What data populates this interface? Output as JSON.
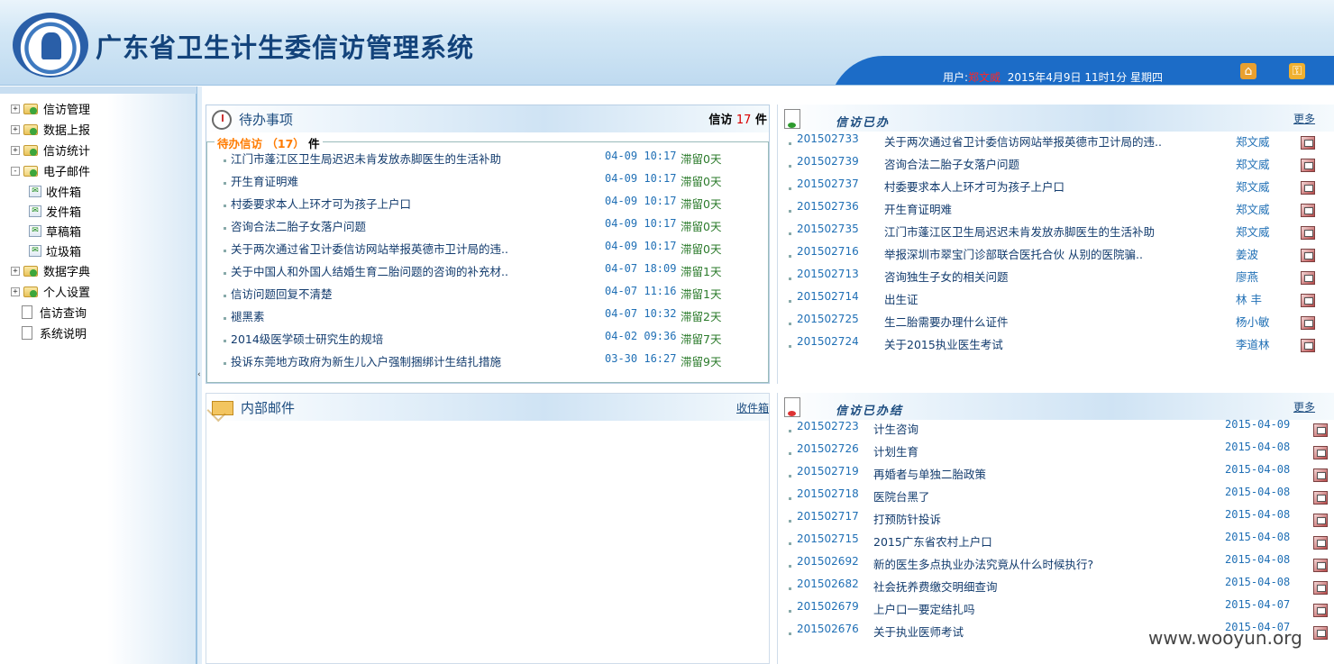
{
  "header": {
    "title": "广东省卫生计生委信访管理系统",
    "user_label": "用户:",
    "user_name": "郑文威",
    "datetime": "2015年4月9日  11时1分  星期四",
    "icons": [
      "home-icon",
      "key-icon"
    ]
  },
  "sidebar": {
    "items": [
      {
        "label": "信访管理",
        "expander": "+",
        "icon": "folder"
      },
      {
        "label": "数据上报",
        "expander": "+",
        "icon": "folder"
      },
      {
        "label": "信访统计",
        "expander": "+",
        "icon": "folder"
      },
      {
        "label": "电子邮件",
        "expander": "-",
        "icon": "folder-open"
      },
      {
        "label": "收件箱",
        "sub": true
      },
      {
        "label": "发件箱",
        "sub": true
      },
      {
        "label": "草稿箱",
        "sub": true
      },
      {
        "label": "垃圾箱",
        "sub": true
      },
      {
        "label": "数据字典",
        "expander": "+",
        "icon": "folder"
      },
      {
        "label": "个人设置",
        "expander": "+",
        "icon": "folder"
      },
      {
        "label": "信访查询",
        "icon": "page"
      },
      {
        "label": "系统说明",
        "icon": "page"
      }
    ],
    "collapse_handle": "‹"
  },
  "todo": {
    "title": "待办事项",
    "count_label": "信访",
    "count": "17",
    "count_unit": "件",
    "legend_label": "待办信访",
    "legend_count": "（17）",
    "legend_unit": "件",
    "items": [
      {
        "title": "江门市蓬江区卫生局迟迟未肯发放赤脚医生的生活补助",
        "time": "04-09 10:17",
        "status": "滞留0天"
      },
      {
        "title": "开生育证明难",
        "time": "04-09 10:17",
        "status": "滞留0天"
      },
      {
        "title": "村委要求本人上环才可为孩子上户口",
        "time": "04-09 10:17",
        "status": "滞留0天"
      },
      {
        "title": "咨询合法二胎子女落户问题",
        "time": "04-09 10:17",
        "status": "滞留0天"
      },
      {
        "title": "关于两次通过省卫计委信访网站举报英德市卫计局的违..",
        "time": "04-09 10:17",
        "status": "滞留0天"
      },
      {
        "title": "关于中国人和外国人结婚生育二胎问题的咨询的补充材..",
        "time": "04-07 18:09",
        "status": "滞留1天"
      },
      {
        "title": "信访问题回复不清楚",
        "time": "04-07 11:16",
        "status": "滞留1天"
      },
      {
        "title": "褪黑素",
        "time": "04-07 10:32",
        "status": "滞留2天"
      },
      {
        "title": "2014级医学硕士研究生的规培",
        "time": "04-02 09:36",
        "status": "滞留7天"
      },
      {
        "title": "投诉东莞地方政府为新生儿入户强制捆绑计生结扎措施",
        "time": "03-30 16:27",
        "status": "滞留9天"
      }
    ]
  },
  "done": {
    "title": "信访已办",
    "more": "更多",
    "items": [
      {
        "id": "201502733",
        "title": "关于两次通过省卫计委信访网站举报英德市卫计局的违..",
        "person": "郑文威"
      },
      {
        "id": "201502739",
        "title": "咨询合法二胎子女落户问题",
        "person": "郑文威"
      },
      {
        "id": "201502737",
        "title": "村委要求本人上环才可为孩子上户口",
        "person": "郑文威"
      },
      {
        "id": "201502736",
        "title": "开生育证明难",
        "person": "郑文威"
      },
      {
        "id": "201502735",
        "title": "江门市蓬江区卫生局迟迟未肯发放赤脚医生的生活补助",
        "person": "郑文威"
      },
      {
        "id": "201502716",
        "title": "举报深圳市翠宝门诊部联合医托合伙  从别的医院骗..",
        "person": "姜波"
      },
      {
        "id": "201502713",
        "title": "咨询独生子女的相关问题",
        "person": "廖燕"
      },
      {
        "id": "201502714",
        "title": "出生证",
        "person": "林  丰"
      },
      {
        "id": "201502725",
        "title": "生二胎需要办理什么证件",
        "person": "杨小敏"
      },
      {
        "id": "201502724",
        "title": "关于2015执业医生考试",
        "person": "李道林"
      }
    ]
  },
  "mail": {
    "title": "内部邮件",
    "inbox_link": "收件箱"
  },
  "closed": {
    "title": "信访已办结",
    "more": "更多",
    "items": [
      {
        "id": "201502723",
        "title": "计生咨询",
        "date": "2015-04-09"
      },
      {
        "id": "201502726",
        "title": "计划生育",
        "date": "2015-04-08"
      },
      {
        "id": "201502719",
        "title": "再婚者与单独二胎政策",
        "date": "2015-04-08"
      },
      {
        "id": "201502718",
        "title": "医院台黑了",
        "date": "2015-04-08"
      },
      {
        "id": "201502717",
        "title": "打预防针投诉",
        "date": "2015-04-08"
      },
      {
        "id": "201502715",
        "title": "2015广东省农村上户口",
        "date": "2015-04-08"
      },
      {
        "id": "201502692",
        "title": "新的医生多点执业办法究竟从什么时候执行?",
        "date": "2015-04-08"
      },
      {
        "id": "201502682",
        "title": "社会抚养费缴交明细查询",
        "date": "2015-04-08"
      },
      {
        "id": "201502679",
        "title": "上户口一要定结扎吗",
        "date": "2015-04-07"
      },
      {
        "id": "201502676",
        "title": "关于执业医师考试",
        "date": "2015-04-07"
      }
    ]
  },
  "watermark": "www.wooyun.org"
}
